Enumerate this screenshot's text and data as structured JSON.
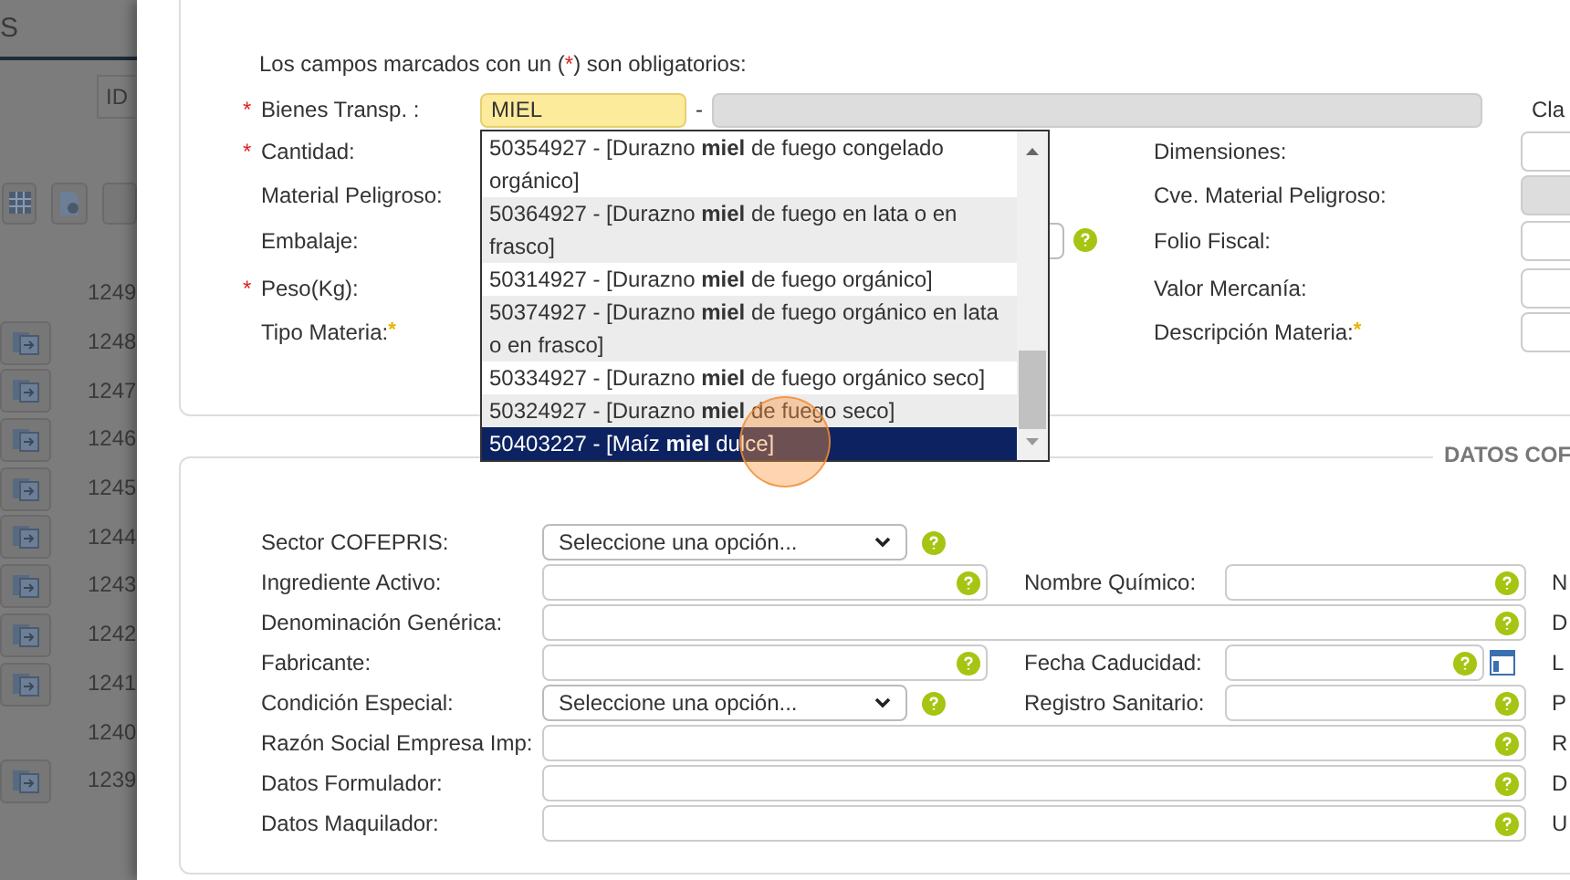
{
  "background_page": {
    "title": "S",
    "column": "ID",
    "rows": [
      {
        "id": "1249",
        "icon": false
      },
      {
        "id": "1248",
        "icon": true
      },
      {
        "id": "1247",
        "icon": true
      },
      {
        "id": "1246",
        "icon": true
      },
      {
        "id": "1245",
        "icon": true
      },
      {
        "id": "1244",
        "icon": true
      },
      {
        "id": "1243",
        "icon": true
      },
      {
        "id": "1242",
        "icon": true
      },
      {
        "id": "1241",
        "icon": true
      },
      {
        "id": "1240",
        "icon": false
      },
      {
        "id": "1239",
        "icon": true
      }
    ]
  },
  "merchandise": {
    "note_start": "Los campos marcados con un (",
    "note_mark": "*",
    "note_end": ") son obligatorios:",
    "rows": [
      {
        "label": "Bienes Transp. :",
        "mark": {
          "kind": "required",
          "text": "*"
        },
        "control": {
          "kind": "autocomplete",
          "value": "MIEL",
          "separator": "-",
          "description_disabled": true,
          "next_label": "Cla"
        }
      },
      {
        "label": "Cantidad:",
        "mark": {
          "kind": "required",
          "text": "*"
        },
        "right": {
          "label": "Dimensiones:",
          "control": {
            "kind": "input",
            "disabled": false
          }
        }
      },
      {
        "label": "Material Peligroso:",
        "right": {
          "label": "Cve. Material Peligroso:",
          "control": {
            "kind": "input",
            "disabled": true
          }
        }
      },
      {
        "label": "Embalaje:",
        "control": {
          "kind": "select",
          "help": true
        },
        "right": {
          "label": "Folio Fiscal:",
          "control": {
            "kind": "input",
            "disabled": false
          }
        }
      },
      {
        "label": "Peso(Kg):",
        "mark": {
          "kind": "required",
          "text": "*"
        },
        "right": {
          "label": "Valor Mercanía:",
          "control": {
            "kind": "input",
            "disabled": false
          }
        }
      },
      {
        "label": "Tipo Materia:",
        "mark": {
          "kind": "note",
          "text": "*"
        },
        "right": {
          "label": "Descripción Materia:",
          "mark": {
            "kind": "note",
            "text": "*"
          },
          "control": {
            "kind": "input",
            "disabled": false
          }
        }
      }
    ],
    "suggestions": [
      {
        "text": "50354927 - [Durazno **miel** de fuego congelado orgánico]",
        "selected": false
      },
      {
        "text": "50364927 - [Durazno **miel** de fuego en lata o en frasco]",
        "selected": false
      },
      {
        "text": "50314927 - [Durazno **miel** de fuego orgánico]",
        "selected": false
      },
      {
        "text": "50374927 - [Durazno **miel** de fuego orgánico en lata o en frasco]",
        "selected": false
      },
      {
        "text": "50334927 - [Durazno **miel** de fuego orgánico seco]",
        "selected": false
      },
      {
        "text": "50324927 - [Durazno **miel** de fuego seco]",
        "selected": false
      },
      {
        "text": "50403227 - [Maíz **miel** dulce]",
        "selected": true
      }
    ]
  },
  "cofepris": {
    "heading": "DATOS COF",
    "rows": [
      {
        "label": "Sector COFEPRIS:",
        "control": {
          "kind": "select",
          "value": "Seleccione una opción...",
          "help": true
        }
      },
      {
        "label": "Ingrediente Activo:",
        "control": {
          "kind": "input",
          "help": true
        },
        "right": {
          "label": "Nombre Químico:",
          "control": {
            "kind": "input",
            "help": true,
            "calendar": false
          }
        },
        "edge": "N"
      },
      {
        "label": "Denominación Genérica:",
        "control": {
          "kind": "wideinput",
          "help": true
        },
        "edge": "D"
      },
      {
        "label": "Fabricante:",
        "control": {
          "kind": "input",
          "help": true
        },
        "right": {
          "label": "Fecha Caducidad:",
          "control": {
            "kind": "input",
            "help": true,
            "calendar": true
          }
        },
        "edge": "L"
      },
      {
        "label": "Condición Especial:",
        "control": {
          "kind": "select",
          "value": "Seleccione una opción...",
          "help": true
        },
        "right": {
          "label": "Registro Sanitario:",
          "control": {
            "kind": "input",
            "help": true,
            "calendar": false
          }
        },
        "edge": "P"
      },
      {
        "label": "Razón Social Empresa Imp:",
        "control": {
          "kind": "wideinput",
          "help": true
        },
        "edge": "R"
      },
      {
        "label": "Datos Formulador:",
        "control": {
          "kind": "wideinput",
          "help": true
        },
        "edge": "D"
      },
      {
        "label": "Datos Maquilador:",
        "control": {
          "kind": "wideinput",
          "help": true
        },
        "edge": "U"
      }
    ]
  }
}
